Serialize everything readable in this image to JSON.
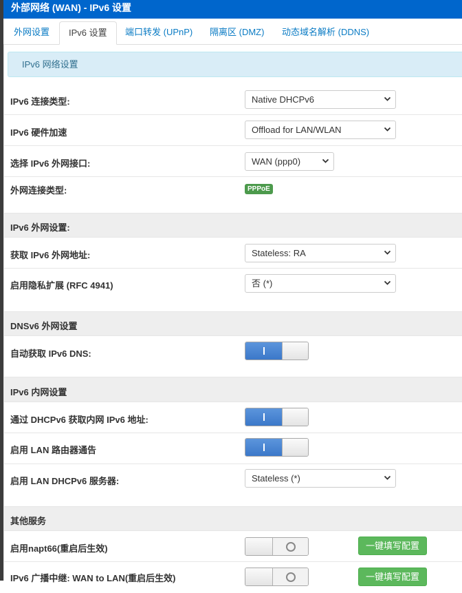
{
  "header": {
    "title": "外部网络 (WAN) - IPv6 设置"
  },
  "tabs": [
    {
      "label": "外网设置",
      "active": false
    },
    {
      "label": "IPv6 设置",
      "active": true
    },
    {
      "label": "端口转发 (UPnP)",
      "active": false
    },
    {
      "label": "隔离区 (DMZ)",
      "active": false
    },
    {
      "label": "动态域名解析 (DDNS)",
      "active": false
    }
  ],
  "info_banner": "IPv6 网络设置",
  "rows": {
    "conn_type": {
      "label": "IPv6 连接类型:",
      "value": "Native DHCPv6"
    },
    "hw_accel": {
      "label": "IPv6 硬件加速",
      "value": "Offload for LAN/WLAN"
    },
    "wan_iface": {
      "label": "选择 IPv6 外网接口:",
      "value": "WAN (ppp0)"
    },
    "wan_conn_type": {
      "label": "外网连接类型:",
      "badge": "PPPoE"
    },
    "wan_section": {
      "label": "IPv6 外网设置:"
    },
    "get_addr": {
      "label": "获取 IPv6 外网地址:",
      "value": "Stateless: RA"
    },
    "privacy": {
      "label": "启用隐私扩展 (RFC 4941)",
      "value": "否 (*)"
    },
    "dns_section": {
      "label": "DNSv6 外网设置"
    },
    "auto_dns": {
      "label": "自动获取 IPv6 DNS:",
      "state": "on"
    },
    "lan_section": {
      "label": "IPv6 内网设置"
    },
    "dhcp_lan": {
      "label": "通过 DHCPv6 获取内网 IPv6 地址:",
      "state": "on"
    },
    "ra": {
      "label": "启用 LAN 路由器通告",
      "state": "on"
    },
    "dhcp_server": {
      "label": "启用 LAN DHCPv6 服务器:",
      "value": "Stateless (*)"
    },
    "other_section": {
      "label": "其他服务"
    },
    "napt66": {
      "label": "启用napt66(重启后生效)",
      "state": "off",
      "button": "一键填写配置"
    },
    "relay": {
      "label": "IPv6 广播中继: WAN to LAN(重启后生效)",
      "state": "off",
      "button": "一键填写配置"
    }
  },
  "icons": {
    "select_arrow": "chevron-down-icon"
  },
  "colors": {
    "header": "#0066cc",
    "tab_link": "#0a7bc4",
    "info_bg": "#d9edf7",
    "toggle_on": "#3b78c9",
    "green": "#5cb85c",
    "badge": "#4c9a4c"
  }
}
